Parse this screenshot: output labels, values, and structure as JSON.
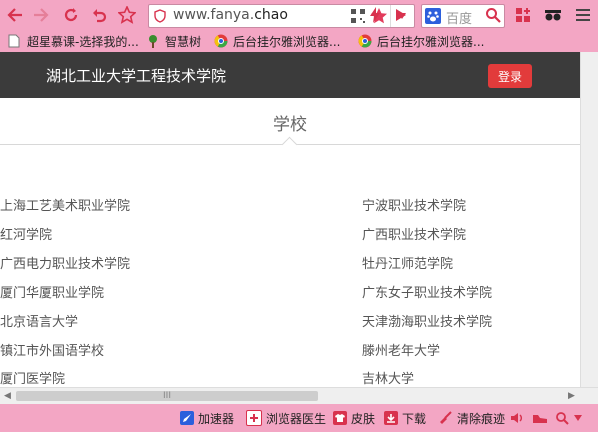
{
  "toolbar": {
    "url_prefix": "www.fanya.",
    "url_suffix": "chao",
    "search_placeholder": "百度",
    "icons": [
      "back-arrow-icon",
      "forward-arrow-icon",
      "reload-icon",
      "undo-icon",
      "star-icon",
      "shield-icon",
      "qr-code-icon",
      "favorite-star-icon",
      "dropdown-icon",
      "lightning-icon",
      "play-icon",
      "baidu-icon",
      "search-icon",
      "apps-icon",
      "mask-icon",
      "menu-icon"
    ]
  },
  "bookmarks": [
    {
      "label": "超星慕课-选择我的..."
    },
    {
      "label": "智慧树"
    },
    {
      "label": "后台挂尔雅浏览器..."
    },
    {
      "label": "后台挂尔雅浏览器..."
    }
  ],
  "header": {
    "title": "湖北工业大学工程技术学院",
    "login_label": "登录"
  },
  "section": {
    "title": "学校"
  },
  "schools": {
    "left": [
      "上海工艺美术职业学院",
      "红河学院",
      "广西电力职业技术学院",
      "厦门华厦职业学院",
      "北京语言大学",
      "镇江市外国语学校",
      "厦门医学院"
    ],
    "right": [
      "宁波职业技术学院",
      "广西职业技术学院",
      "牡丹江师范学院",
      "广东女子职业技术学院",
      "天津渤海职业技术学院",
      "滕州老年大学",
      "吉林大学"
    ]
  },
  "hscroll": {
    "thumb_label": "III"
  },
  "statusbar": {
    "items": [
      {
        "label": "加速器",
        "color": "#2c5fdc"
      },
      {
        "label": "浏览器医生",
        "color": "#d8324e"
      },
      {
        "label": "皮肤",
        "color": "#d8324e"
      },
      {
        "label": "下载",
        "color": "#d8324e"
      },
      {
        "label": "清除痕迹",
        "color": "#d8324e"
      }
    ]
  },
  "colors": {
    "chrome": "#f3a6c4",
    "header_bg": "#3b3b3b",
    "login_bg": "#e23b3b"
  }
}
